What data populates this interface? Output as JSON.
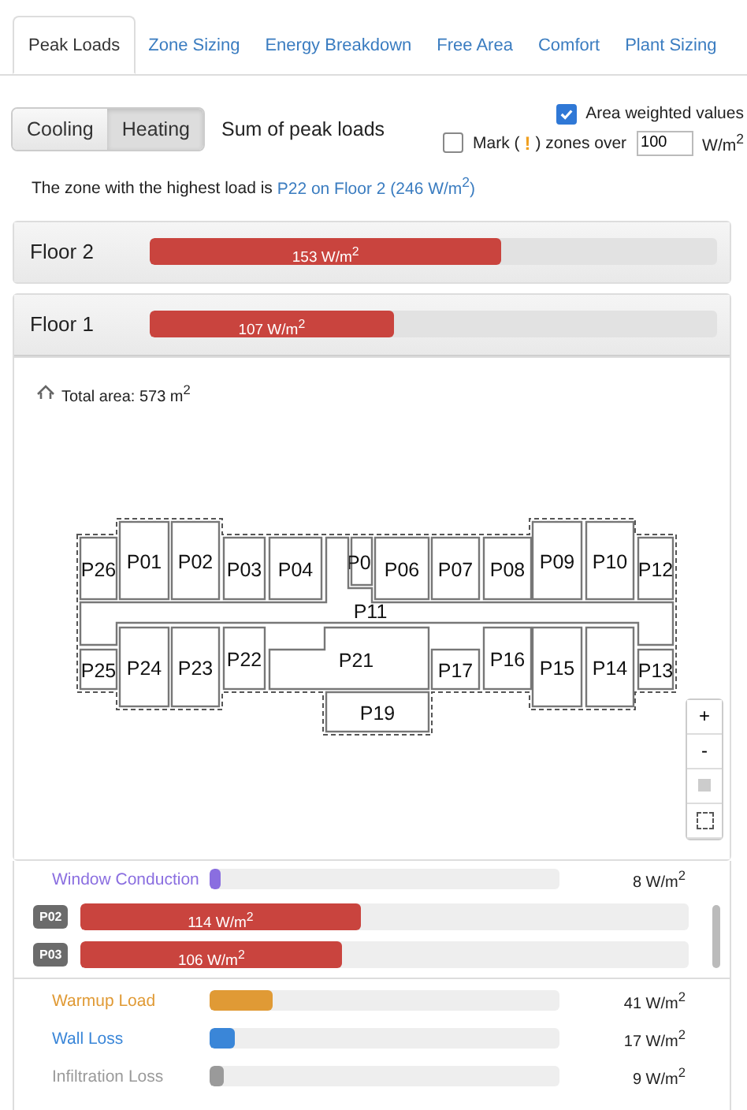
{
  "tabs": [
    {
      "label": "Peak Loads",
      "selected": true
    },
    {
      "label": "Zone Sizing",
      "selected": false
    },
    {
      "label": "Energy Breakdown",
      "selected": false
    },
    {
      "label": "Free Area",
      "selected": false
    },
    {
      "label": "Comfort",
      "selected": false
    },
    {
      "label": "Plant Sizing",
      "selected": false
    }
  ],
  "mode_toggle": [
    {
      "label": "Cooling",
      "selected": false
    },
    {
      "label": "Heating",
      "selected": true
    }
  ],
  "summary_label": "Sum of peak loads",
  "area_weighted": {
    "label": "Area weighted values",
    "checked": true
  },
  "mark_zones": {
    "checked": false,
    "label_before": "Mark (",
    "icon": "!",
    "label_after": ") zones over",
    "value": "100",
    "unit": "W/m$^{2}$"
  },
  "highest_load": {
    "text": "The zone with the highest load is",
    "link": "P22 on Floor 2 (246 W/m$^{2}$)"
  },
  "floors": [
    {
      "name": "Floor 2",
      "value": "153 W/m$^{2}$",
      "level": 0.62,
      "expanded": false
    },
    {
      "name": "Floor 1",
      "value": "107 W/m$^{2}$",
      "level": 0.43,
      "expanded": true
    }
  ],
  "floor_plan": {
    "total_area": "Total area: 573 m$^{2}$",
    "rooms": [
      {
        "label": "P26"
      },
      {
        "label": "P01"
      },
      {
        "label": "P02"
      },
      {
        "label": "P03"
      },
      {
        "label": "P04"
      },
      {
        "label": "P0"
      },
      {
        "label": "P06"
      },
      {
        "label": "P07"
      },
      {
        "label": "P08"
      },
      {
        "label": "P09"
      },
      {
        "label": "P10"
      },
      {
        "label": "P12"
      },
      {
        "label": "P11"
      },
      {
        "label": "P25"
      },
      {
        "label": "P24"
      },
      {
        "label": "P23"
      },
      {
        "label": "P22"
      },
      {
        "label": "P21"
      },
      {
        "label": "P17"
      },
      {
        "label": "P16"
      },
      {
        "label": "P15"
      },
      {
        "label": "P14"
      },
      {
        "label": "P13"
      },
      {
        "label": "P19"
      }
    ],
    "zoom_in": "+",
    "zoom_out": "-"
  },
  "zone_list": [
    {
      "kind": "component",
      "label": "Window Conduction",
      "color": "#8a6ee0",
      "level": 0.03,
      "value": "8 W/m$^{2}$"
    },
    {
      "kind": "zone",
      "label": "P02",
      "level": 0.46,
      "value": "114 W/m$^{2}$"
    },
    {
      "kind": "zone",
      "label": "P03",
      "level": 0.43,
      "value": "106 W/m$^{2}$"
    },
    {
      "kind": "divider"
    },
    {
      "kind": "component",
      "label": "Warmup Load",
      "color": "#e09a35",
      "level": 0.18,
      "value": "41 W/m$^{2}$"
    },
    {
      "kind": "component",
      "label": "Wall Loss",
      "color": "#3a86d8",
      "level": 0.07,
      "value": "17 W/m$^{2}$"
    },
    {
      "kind": "component",
      "label": "Infiltration Loss",
      "color": "#9a9a9a",
      "level": 0.04,
      "value": "9 W/m$^{2}$"
    }
  ]
}
